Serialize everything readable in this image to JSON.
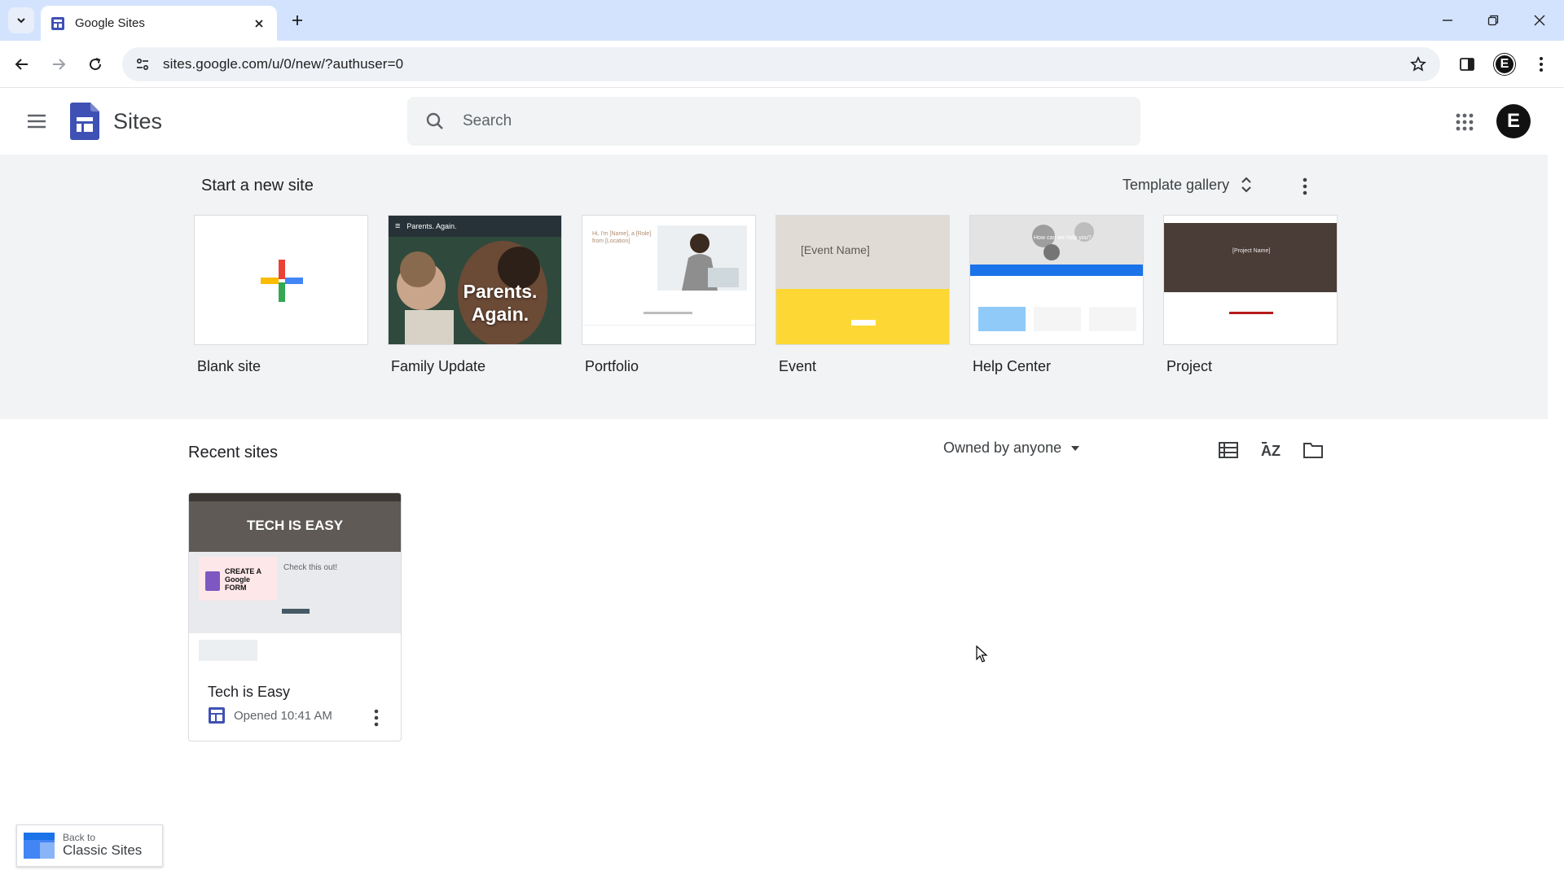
{
  "browser": {
    "tab_title": "Google Sites",
    "url": "sites.google.com/u/0/new/?authuser=0",
    "profile_initial": "E"
  },
  "header": {
    "app_name": "Sites",
    "search_placeholder": "Search",
    "avatar_initial": "E"
  },
  "templates": {
    "section_title": "Start a new site",
    "gallery_label": "Template gallery",
    "items": [
      {
        "label": "Blank site"
      },
      {
        "label": "Family Update",
        "thumb_title": "Parents. Again.",
        "thumb_heading": "Parents. Again."
      },
      {
        "label": "Portfolio",
        "thumb_heading": "Hi, I'm [Name], a [Role] from [Location]"
      },
      {
        "label": "Event",
        "thumb_heading": "[Event Name]"
      },
      {
        "label": "Help Center",
        "thumb_heading": "How can we help you?"
      },
      {
        "label": "Project",
        "thumb_heading": "[Project Name]"
      }
    ]
  },
  "recent": {
    "section_title": "Recent sites",
    "owner_filter": "Owned by anyone",
    "sites": [
      {
        "name": "Tech is Easy",
        "opened": "Opened 10:41 AM",
        "thumb_banner": "TECH IS EASY",
        "thumb_text": "Check this out!",
        "thumb_card": "CREATE A Google FORM"
      }
    ]
  },
  "back_to_classic": {
    "line1": "Back to",
    "line2": "Classic Sites"
  },
  "colors": {
    "tabstrip": "#d3e3fd",
    "band": "#f1f3f4",
    "sites_blue": "#3f51b5",
    "event_yellow": "#fdd835",
    "help_blue": "#1a73e8"
  }
}
